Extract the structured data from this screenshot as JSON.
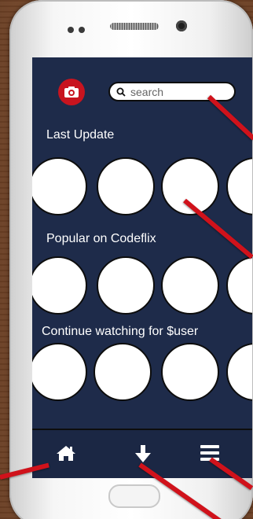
{
  "header": {
    "logo_icon": "camera-icon",
    "search": {
      "placeholder": "search",
      "value": ""
    }
  },
  "sections": [
    {
      "title": "Last Update"
    },
    {
      "title": "Popular on Codeflix"
    },
    {
      "title": "Continue watching for $user"
    }
  ],
  "bottom_nav": {
    "items": [
      {
        "icon": "home-icon"
      },
      {
        "icon": "download-icon"
      },
      {
        "icon": "menu-icon"
      }
    ]
  },
  "colors": {
    "screen_bg": "#1e2b4a",
    "accent": "#c8141f",
    "annotation_arrow": "#d0121b"
  }
}
